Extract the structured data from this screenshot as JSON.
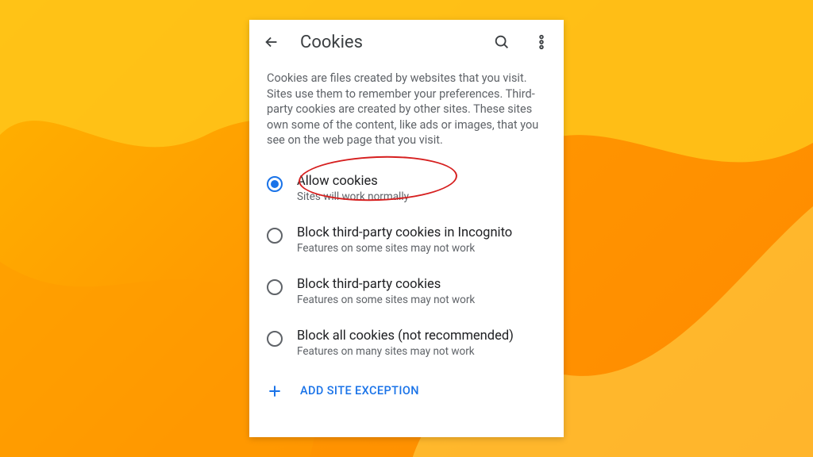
{
  "header": {
    "title": "Cookies"
  },
  "description": "Cookies are files created by websites that you visit. Sites use them to remember your preferences. Third-party cookies are created by other sites. These sites own some of the content, like ads or images, that you see on the web page that you visit.",
  "options": [
    {
      "title": "Allow cookies",
      "subtitle": "Sites will work normally",
      "selected": true
    },
    {
      "title": "Block third-party cookies in Incognito",
      "subtitle": "Features on some sites may not work",
      "selected": false
    },
    {
      "title": "Block third-party cookies",
      "subtitle": "Features on some sites may not work",
      "selected": false
    },
    {
      "title": "Block all cookies (not recommended)",
      "subtitle": "Features on many sites may not work",
      "selected": false
    }
  ],
  "actions": {
    "add_exception": "ADD SITE EXCEPTION"
  },
  "colors": {
    "accent": "#1a73e8",
    "annotation": "#d61f1f",
    "bg_a": "#ffb400",
    "bg_b": "#ff8a00"
  }
}
